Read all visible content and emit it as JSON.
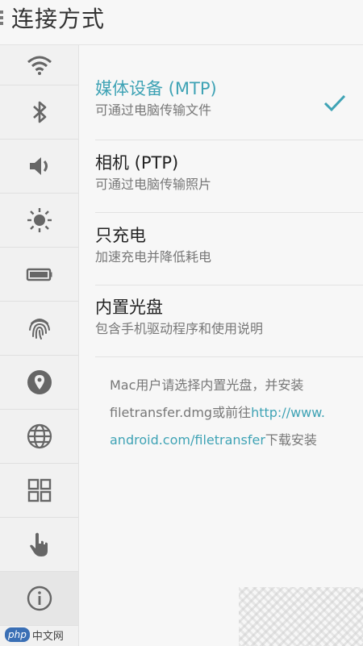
{
  "header": {
    "title": "连接方式"
  },
  "sidebar": {
    "items": [
      {
        "icon": "wifi-icon"
      },
      {
        "icon": "bluetooth-icon"
      },
      {
        "icon": "volume-icon"
      },
      {
        "icon": "brightness-icon"
      },
      {
        "icon": "battery-icon"
      },
      {
        "icon": "fingerprint-icon"
      },
      {
        "icon": "location-icon"
      },
      {
        "icon": "globe-icon"
      },
      {
        "icon": "apps-grid-icon"
      },
      {
        "icon": "hand-pointer-icon"
      },
      {
        "icon": "info-icon"
      }
    ]
  },
  "options": [
    {
      "title": "媒体设备 (MTP)",
      "subtitle": "可通过电脑传输文件",
      "selected": true
    },
    {
      "title": "相机 (PTP)",
      "subtitle": "可通过电脑传输照片",
      "selected": false
    },
    {
      "title": "只充电",
      "subtitle": "加速充电并降低耗电",
      "selected": false
    },
    {
      "title": "内置光盘",
      "subtitle": "包含手机驱动程序和使用说明",
      "selected": false
    }
  ],
  "note": {
    "line1": "Mac用户请选择内置光盘，并安装",
    "line2_prefix": "filetransfer.dmg或前往",
    "link_part1": "http://www.",
    "link_part2": "android.com/filetransfer",
    "line3_suffix": "下载安装"
  },
  "colors": {
    "accent": "#3fa3b5",
    "text": "#222222",
    "subtext": "#777777"
  },
  "watermark": {
    "badge": "php",
    "text": "中文网"
  }
}
